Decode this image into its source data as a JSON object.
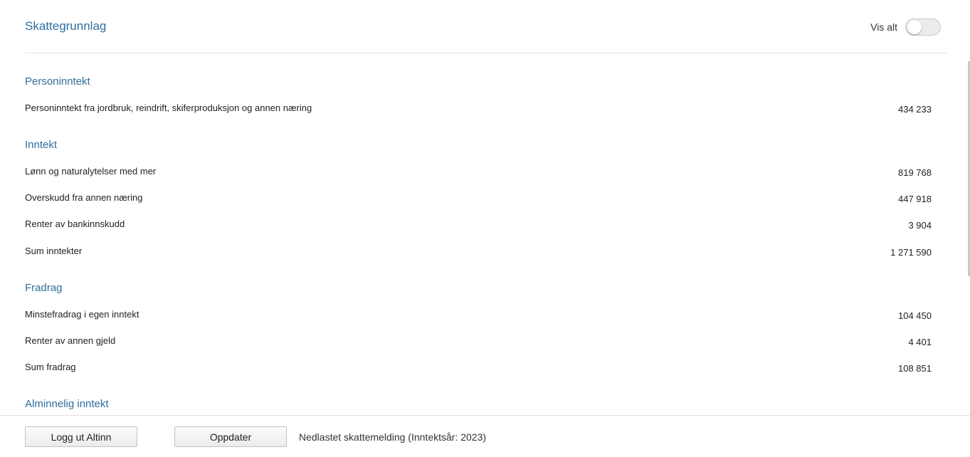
{
  "header": {
    "title": "Skattegrunnlag",
    "toggle_label": "Vis alt",
    "toggle_on": false
  },
  "sections": [
    {
      "title": "Personinntekt",
      "rows": [
        {
          "label": "Personinntekt fra jordbruk, reindrift, skiferproduksjon og annen næring",
          "value": "434 233"
        }
      ]
    },
    {
      "title": "Inntekt",
      "rows": [
        {
          "label": "Lønn og naturalytelser med mer",
          "value": "819 768"
        },
        {
          "label": "Overskudd fra annen næring",
          "value": "447 918"
        },
        {
          "label": "Renter av bankinnskudd",
          "value": "3 904"
        },
        {
          "label": "Sum inntekter",
          "value": "1 271 590"
        }
      ]
    },
    {
      "title": "Fradrag",
      "rows": [
        {
          "label": "Minstefradrag i egen inntekt",
          "value": "104 450"
        },
        {
          "label": "Renter av annen gjeld",
          "value": "4 401"
        },
        {
          "label": "Sum fradrag",
          "value": "108 851"
        }
      ]
    },
    {
      "title": "Alminnelig inntekt",
      "rows": []
    }
  ],
  "footer": {
    "logout_label": "Logg ut Altinn",
    "update_label": "Oppdater",
    "status": "Nedlastet skattemelding (Inntektsår: 2023)"
  }
}
